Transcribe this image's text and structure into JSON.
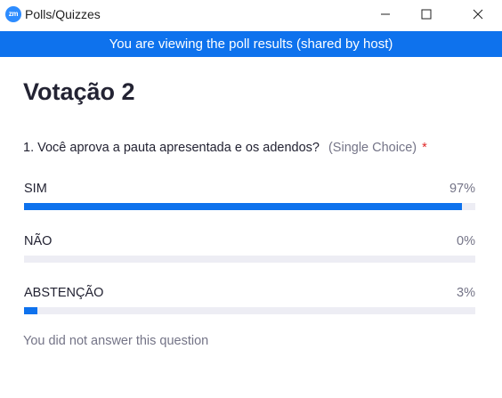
{
  "window": {
    "logo_text": "zm",
    "title": "Polls/Quizzes",
    "controls": {
      "minimize_icon": "minimize-icon",
      "maximize_icon": "maximize-icon",
      "close_icon": "close-icon"
    }
  },
  "banner": {
    "text": "You are viewing the poll results (shared by host)"
  },
  "poll": {
    "title": "Votação 2",
    "question": {
      "text": "1. Você aprova a pauta apresentada e os adendos?",
      "type": "(Single Choice)",
      "required_marker": "*",
      "answers": [
        {
          "label": "SIM",
          "percent_text": "97%",
          "percent": 97
        },
        {
          "label": "NÃO",
          "percent_text": "0%",
          "percent": 0
        },
        {
          "label": "ABSTENÇÃO",
          "percent_text": "3%",
          "percent": 3
        }
      ],
      "note": "You did not answer this question"
    }
  },
  "colors": {
    "accent": "#0e72ed",
    "bar_track": "#ededf4",
    "required": "#e02828",
    "muted_text": "#747487",
    "text": "#232333"
  }
}
